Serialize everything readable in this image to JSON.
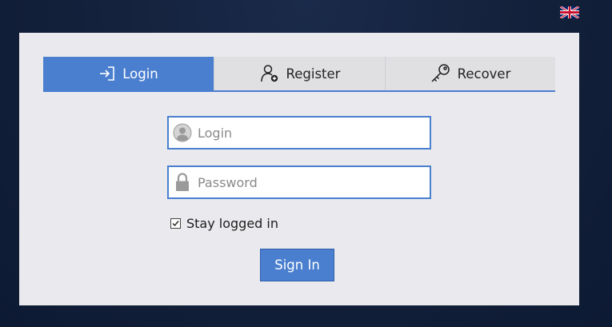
{
  "header": {
    "language_icon": "uk-flag-icon"
  },
  "tabs": [
    {
      "label": "Login",
      "icon": "sign-in-icon",
      "active": true
    },
    {
      "label": "Register",
      "icon": "user-add-icon",
      "active": false
    },
    {
      "label": "Recover",
      "icon": "key-icon",
      "active": false
    }
  ],
  "form": {
    "login_placeholder": "Login",
    "login_value": "",
    "password_placeholder": "Password",
    "password_value": "",
    "stay_logged_in_label": "Stay logged in",
    "stay_logged_in_checked": true,
    "submit_label": "Sign In"
  },
  "colors": {
    "accent": "#4a7fd0",
    "panel_background": "#eaeaee",
    "page_background": "#13203a"
  }
}
